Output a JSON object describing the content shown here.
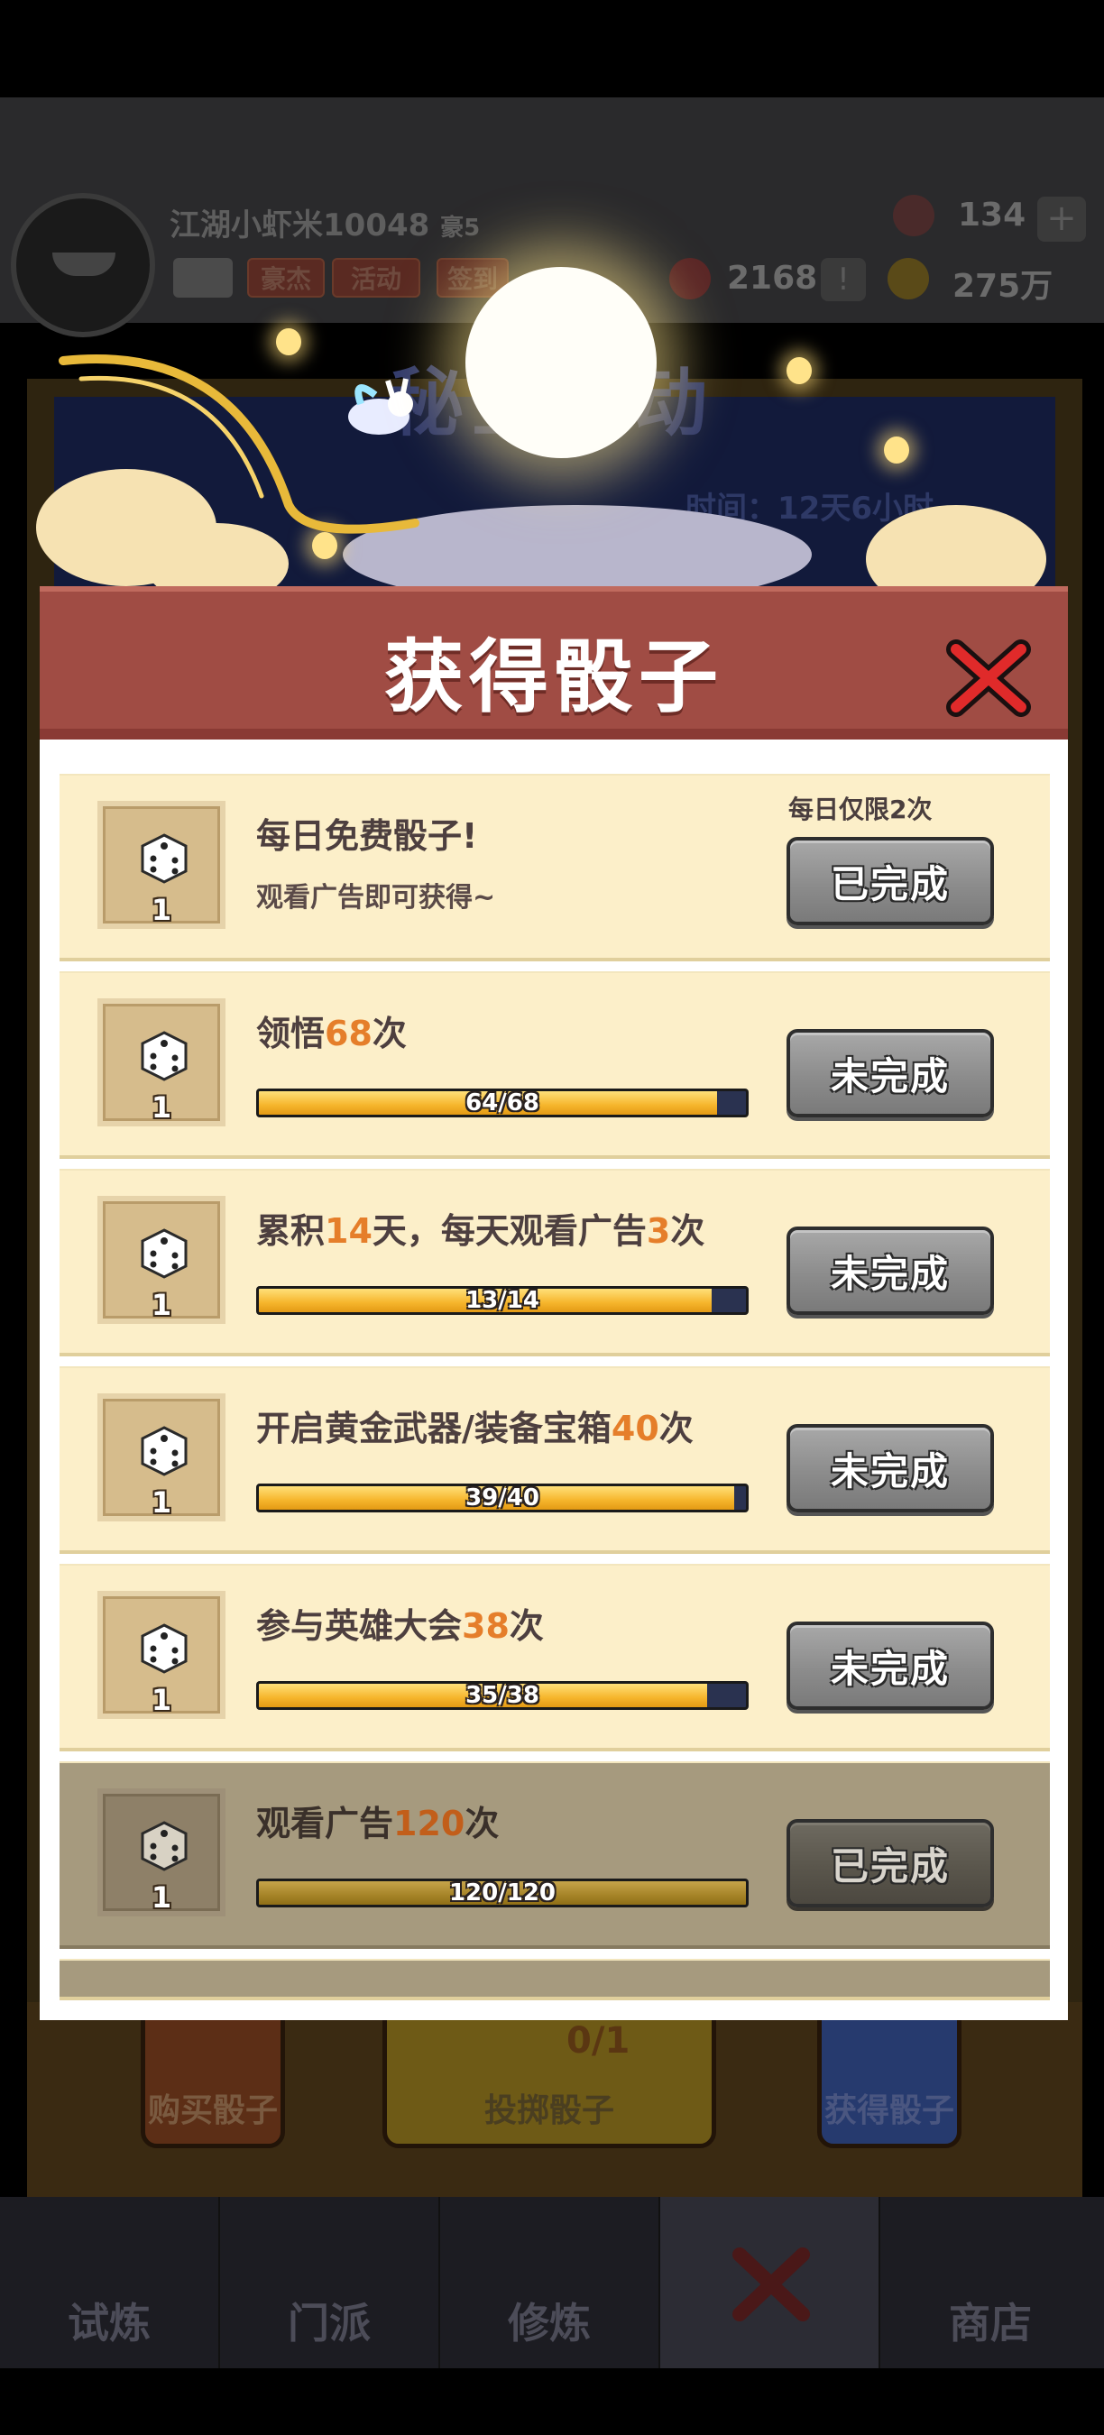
{
  "background": {
    "player_name": "江湖小虾米10048",
    "vip_label": "豪5",
    "chips": [
      "豪杰",
      "活动",
      "签到"
    ],
    "resources": {
      "gems": "134",
      "tokens": "2168",
      "coins": "275万"
    },
    "event_title": "秘宝活动",
    "event_timer": "时间：12天6小时",
    "bottom_buttons": {
      "buy": "购买骰子",
      "throw": "投掷骰子",
      "throw_count": "0/1",
      "get": "获得骰子"
    },
    "tabs": [
      "试炼",
      "门派",
      "修炼",
      "",
      "商店"
    ]
  },
  "modal": {
    "title": "获得骰子",
    "close_icon": "close-x-icon",
    "tasks": [
      {
        "title": "每日免费骰子!",
        "subtitle": "观看广告即可获得~",
        "limit_note": "每日仅限2次",
        "reward_qty": "1",
        "button": "已完成",
        "state": "done"
      },
      {
        "title_pre": "领悟",
        "title_hl": "68",
        "title_post": "次",
        "progress_text": "64/68",
        "progress": 0.941,
        "reward_qty": "1",
        "button": "未完成",
        "state": "incomplete"
      },
      {
        "title_pre": "累积",
        "title_hl": "14",
        "title_mid": "天，每天观看广告",
        "title_hl2": "3",
        "title_post": "次",
        "progress_text": "13/14",
        "progress": 0.929,
        "reward_qty": "1",
        "button": "未完成",
        "state": "incomplete"
      },
      {
        "title_pre": "开启黄金武器/装备宝箱",
        "title_hl": "40",
        "title_post": "次",
        "progress_text": "39/40",
        "progress": 0.975,
        "reward_qty": "1",
        "button": "未完成",
        "state": "incomplete"
      },
      {
        "title_pre": "参与英雄大会",
        "title_hl": "38",
        "title_post": "次",
        "progress_text": "35/38",
        "progress": 0.921,
        "reward_qty": "1",
        "button": "未完成",
        "state": "incomplete"
      },
      {
        "title_pre": "观看广告",
        "title_hl": "120",
        "title_post": "次",
        "progress_text": "120/120",
        "progress": 1.0,
        "reward_qty": "1",
        "button": "已完成",
        "state": "done-dim"
      }
    ]
  },
  "colors": {
    "header_red": "#a04c44",
    "row_cream": "#fcefc9",
    "highlight_orange": "#e57e2a",
    "progress_gold": "#f6b52c",
    "button_gray": "#8c8c8c"
  }
}
